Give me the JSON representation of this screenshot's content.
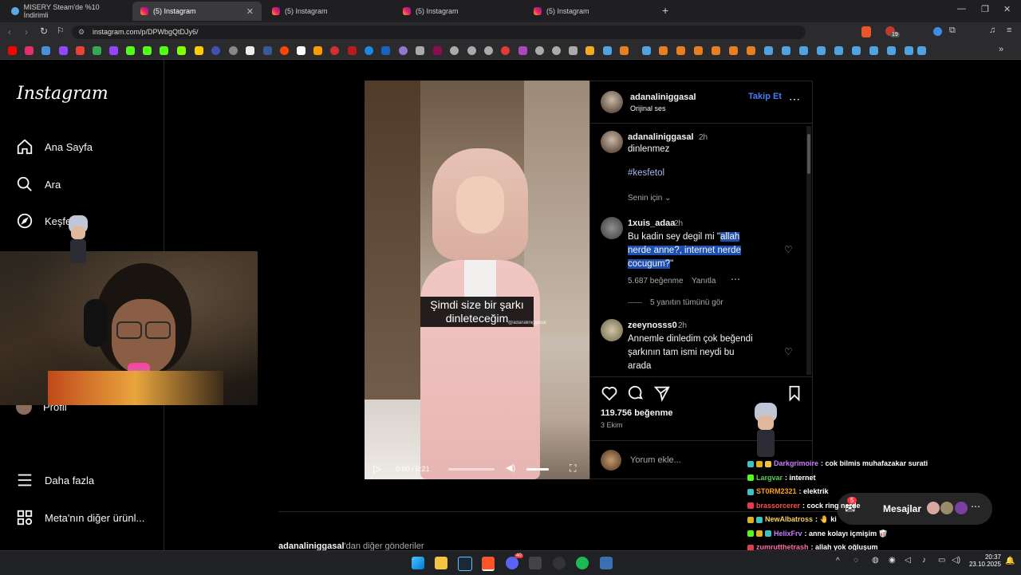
{
  "browser": {
    "tabs": [
      {
        "title": "MISERY Steam'de %10 İndirimli",
        "icon": "steam-icon"
      },
      {
        "title": "(5) Instagram",
        "icon": "instagram-icon",
        "active": true
      },
      {
        "title": "(5) Instagram",
        "icon": "instagram-icon"
      },
      {
        "title": "(5) Instagram",
        "icon": "instagram-icon"
      },
      {
        "title": "(5) Instagram",
        "icon": "instagram-icon"
      }
    ],
    "url": "instagram.com/p/DPWbgQtDJy6/",
    "extension_badge": "19"
  },
  "sidebar": {
    "logo": "Instagram",
    "items": [
      {
        "label": "Ana Sayfa",
        "icon": "home-icon"
      },
      {
        "label": "Ara",
        "icon": "search-icon"
      },
      {
        "label": "Keşfet",
        "icon": "compass-icon"
      },
      {
        "label": "Profil",
        "icon": "avatar-icon"
      },
      {
        "label": "Daha fazla",
        "icon": "menu-icon"
      },
      {
        "label": "Meta'nın diğer ürünl...",
        "icon": "grid-icon"
      }
    ]
  },
  "post": {
    "author": "adanaliniggasal",
    "audio": "Orijinal ses",
    "follow_label": "Takip Et",
    "caption": {
      "user": "adanaliniggasal",
      "time": "2h",
      "text": "dinlenmez",
      "hashtag": "#kesfetol"
    },
    "sort_label": "Senin için",
    "comments": [
      {
        "user": "1xuis_adaa",
        "time": "2h",
        "text_prefix": "Bu kadin sey degil mi \"",
        "text_highlight_1": "allah",
        "text_highlight_2": "nerde anne?, internet nerde",
        "text_highlight_3": "cocugum?",
        "text_suffix": "\"",
        "likes": "5.687 beğenme",
        "reply": "Yanıtla",
        "view_replies": "5 yanıtın tümünü gör"
      },
      {
        "user": "zeeynosss0",
        "time": "2h",
        "text_line_1": "Annemle dinledim çok beğendi",
        "text_line_2": "şarkının tam ismi neydi bu",
        "text_line_3": "arada"
      }
    ],
    "likes": "119.756 beğenme",
    "date": "3 Ekim",
    "comment_placeholder": "Yorum ekle...",
    "video": {
      "subtitle_line_1": "Şimdi size bir şarkı",
      "subtitle_line_2": "dinleteceğim",
      "watermark": "@adanaliniggasal",
      "time": "0:00 / 0:21"
    },
    "more_from_prefix": "adanaliniggasal",
    "more_from_suffix": "'dan diğer gönderiler"
  },
  "messages": {
    "label": "Mesajlar",
    "unread": "5"
  },
  "chat": [
    {
      "user": "Darkgrimoire",
      "color": "#c77dff",
      "text": ": cok bilmis muhafazakar surati"
    },
    {
      "user": "Largvar",
      "color": "#53c653",
      "text": ": internet"
    },
    {
      "user": "ST0RM2321",
      "color": "#ff9f1c",
      "text": ": elektrik"
    },
    {
      "user": "brassorcerer",
      "color": "#ff4d4d",
      "text": ": cock ring nerde"
    },
    {
      "user": "NewAlbatross",
      "color": "#f4d35e",
      "text": ": 🤚 ki"
    },
    {
      "user": "HelixFrv",
      "color": "#c77dff",
      "text": ": anne kolayı içmişim 🥡"
    },
    {
      "user": "zumrutthetrash",
      "color": "#ff6fa8",
      "text": ": allah yok oğluşum"
    }
  ],
  "taskbar": {
    "time": "20:37",
    "date": "23.10.2025",
    "discord_badge": "40"
  }
}
